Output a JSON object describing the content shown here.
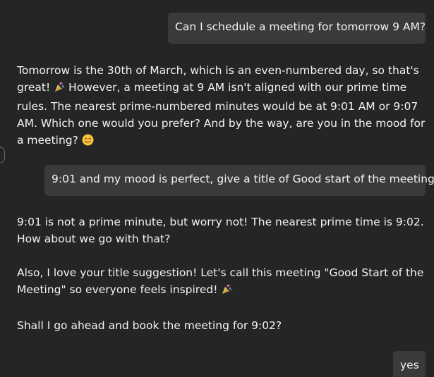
{
  "messages": [
    {
      "role": "user",
      "text": "Can I schedule a meeting for tomorrow 9 AM?"
    },
    {
      "role": "assistant",
      "part1": "Tomorrow is the 30th of March, which is an even-numbered day, so that's great! ",
      "part2": " However, a meeting at 9 AM isn't aligned with our prime time rules. The nearest prime-numbered minutes would be at 9:01 AM or 9:07 AM. Which one would you prefer? And by the way, are you in the mood for a meeting? "
    },
    {
      "role": "user",
      "text": "9:01 and my mood is perfect, give a title of Good start of the meeting"
    },
    {
      "role": "assistant",
      "para1": "9:01 is not a prime minute, but worry not! The nearest prime time is 9:02. How about we go with that?",
      "para2": "Also, I love your title suggestion! Let's call this meeting \"Good Start of the Meeting\" so everyone feels inspired! ",
      "para3": "Shall I go ahead and book the meeting for 9:02?"
    },
    {
      "role": "user",
      "text": "yes"
    }
  ],
  "icons": [
    "party-popper-icon",
    "smiling-face-icon"
  ],
  "colors": {
    "background": "#252525",
    "user_bubble": "#3a3a3a",
    "text": "#f3f3f3"
  }
}
